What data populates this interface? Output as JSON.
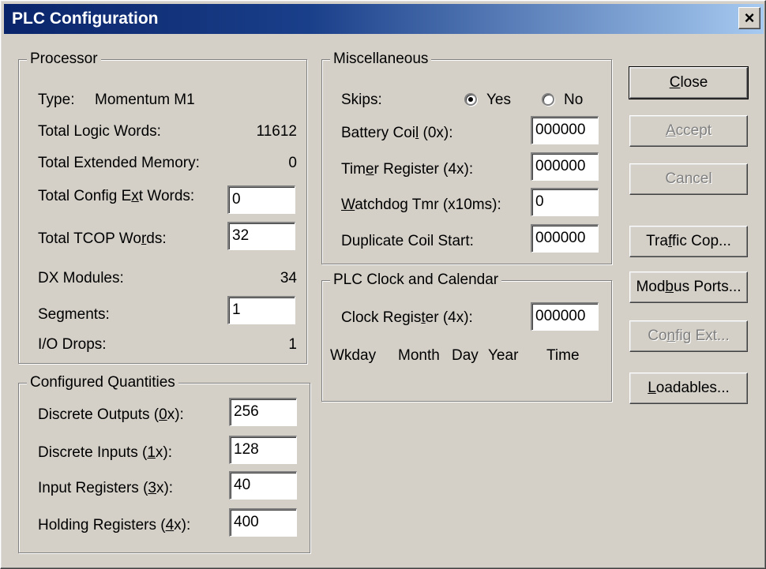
{
  "window": {
    "title": "PLC Configuration",
    "close_glyph": "×"
  },
  "processor": {
    "legend": "Processor",
    "type_label": "Type:",
    "type_value": "Momentum M1",
    "total_logic_words_label": "Total Logic Words:",
    "total_logic_words_value": "11612",
    "total_extended_memory_label": "Total Extended Memory:",
    "total_extended_memory_value": "0",
    "total_config_ext_words_label": "Total Config Ext Words:",
    "total_config_ext_words_value": "0",
    "total_tcop_words_label": "Total TCOP Words:",
    "total_tcop_words_value": "32",
    "dx_modules_label": "DX Modules:",
    "dx_modules_value": "34",
    "segments_label": "Segments:",
    "segments_value": "1",
    "io_drops_label": "I/O Drops:",
    "io_drops_value": "1"
  },
  "configured_quantities": {
    "legend": "Configured Quantities",
    "discrete_outputs_label": "Discrete Outputs (0x):",
    "discrete_outputs_value": "256",
    "discrete_inputs_label": "Discrete Inputs (1x):",
    "discrete_inputs_value": "128",
    "input_registers_label": "Input Registers (3x):",
    "input_registers_value": "40",
    "holding_registers_label": "Holding Registers  (4x):",
    "holding_registers_value": "400"
  },
  "miscellaneous": {
    "legend": "Miscellaneous",
    "skips_label": "Skips:",
    "skips_yes_label": "Yes",
    "skips_no_label": "No",
    "skips_selected": "Yes",
    "battery_coil_label": "Battery Coil (0x):",
    "battery_coil_value": "000000",
    "timer_register_label": "Timer Register (4x):",
    "timer_register_value": "000000",
    "watchdog_label": "Watchdog Tmr (x10ms):",
    "watchdog_value": "0",
    "duplicate_coil_label": "Duplicate Coil Start:",
    "duplicate_coil_value": "000000"
  },
  "clock": {
    "legend": "PLC Clock and Calendar",
    "clock_register_label": "Clock Register (4x):",
    "clock_register_value": "000000",
    "header_wkday": "Wkday",
    "header_month": "Month",
    "header_day": "Day",
    "header_year": "Year",
    "header_time": "Time"
  },
  "buttons": {
    "close": "Close",
    "accept": "Accept",
    "cancel": "Cancel",
    "traffic_cop": "Traffic Cop...",
    "modbus_ports": "Modbus Ports...",
    "config_ext": "Config Ext...",
    "loadables": "Loadables..."
  }
}
